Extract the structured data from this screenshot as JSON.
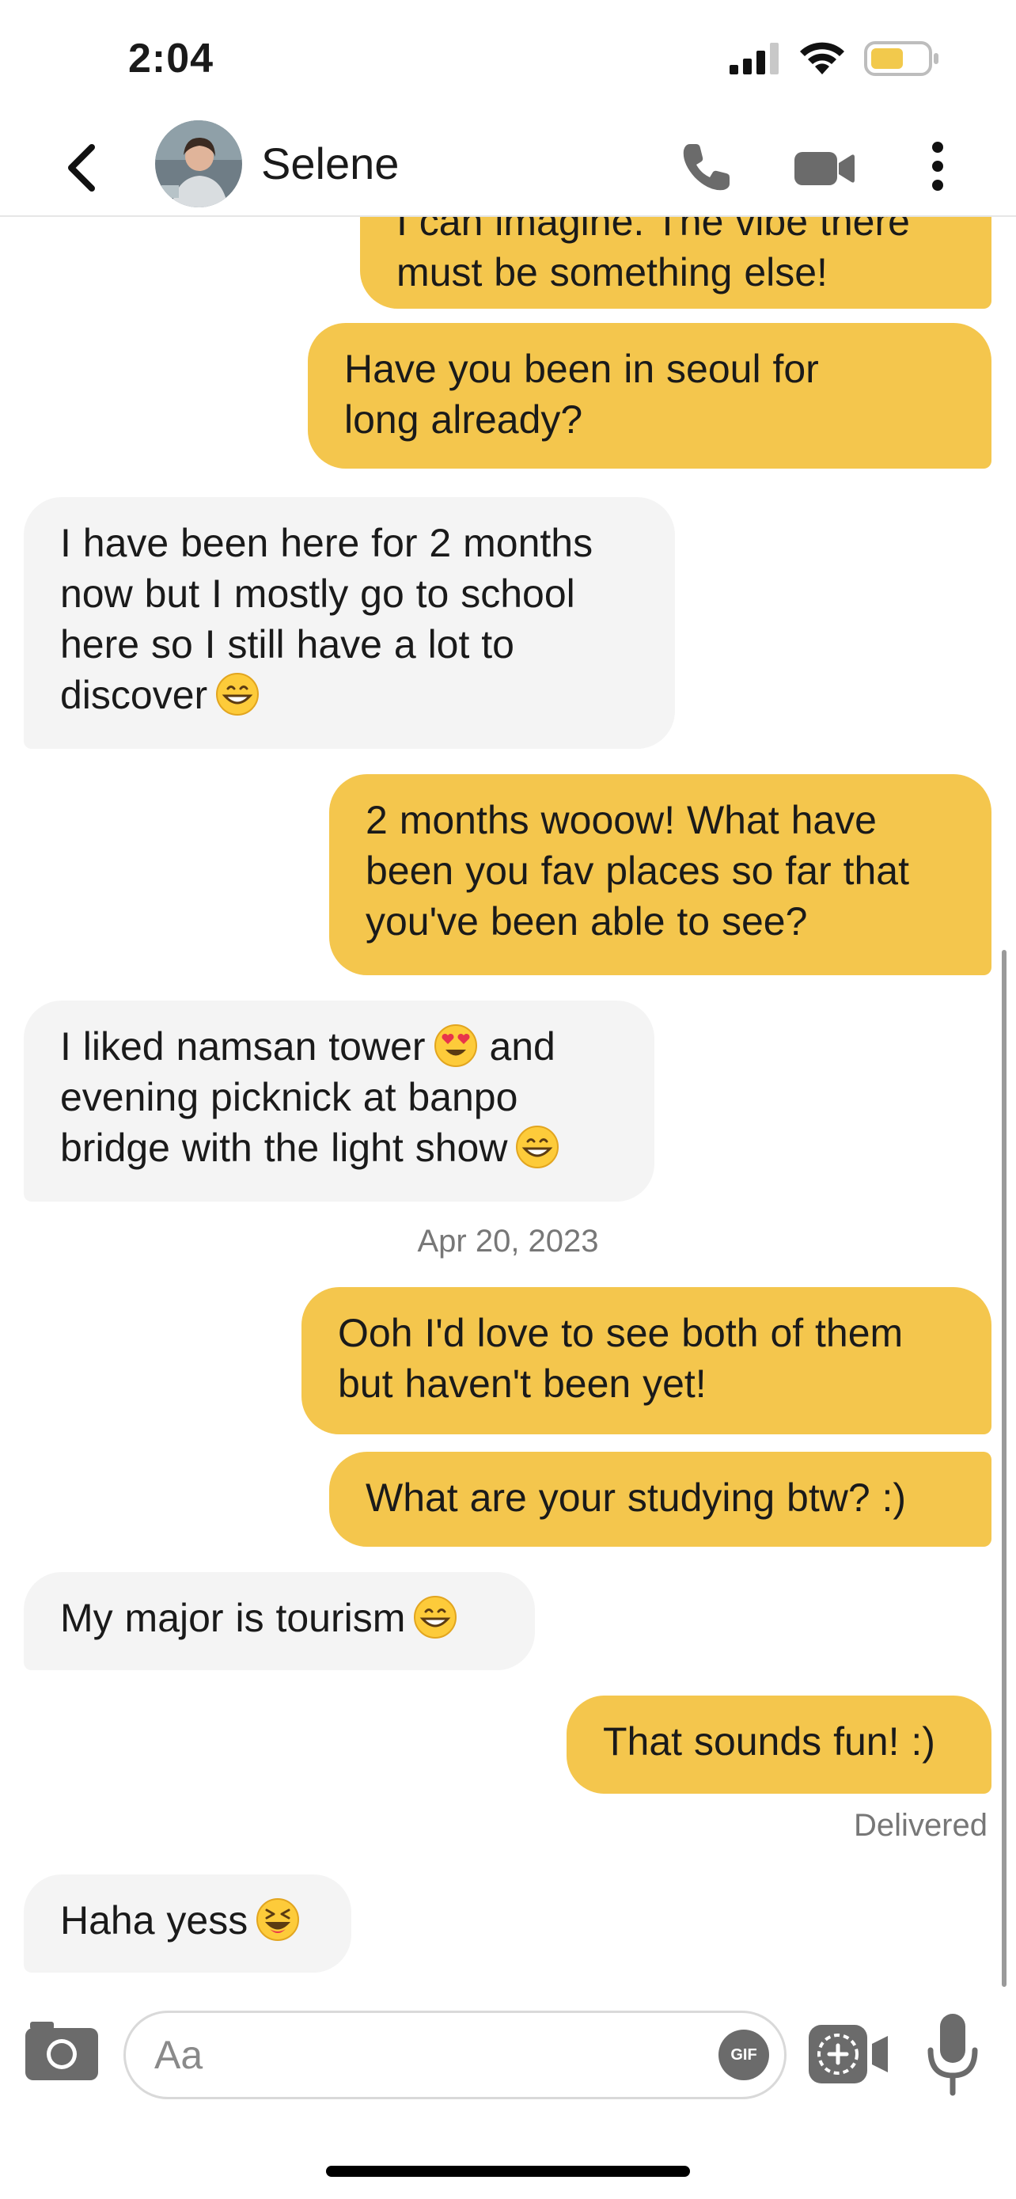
{
  "status_bar": {
    "time": "2:04",
    "battery_color": "#f2c94c"
  },
  "header": {
    "contact_name": "Selene",
    "icons": [
      "back-chevron-icon",
      "phone-icon",
      "video-camera-icon",
      "more-vertical-icon"
    ]
  },
  "messages": [
    {
      "side": "out",
      "text": "I can imagine. The vibe there\nmust be something else!"
    },
    {
      "side": "out",
      "text": "Have you been in seoul for\nlong already?"
    },
    {
      "side": "in",
      "text": "I have been here for 2 months\nnow but I mostly go to school\nhere so I still have a lot to\ndiscover",
      "emoji": "grinning-face"
    },
    {
      "side": "out",
      "text": "2 months wooow! What have\nbeen you fav places so far that\nyou've been able to see?"
    },
    {
      "side": "in",
      "text_a": "I liked namsan tower",
      "emoji_a": "heart-eyes",
      "text_b": " and\nevening picknick at banpo\nbridge with the light show",
      "emoji_b": "grinning-face"
    },
    {
      "side": "out",
      "text": "Ooh I'd love to see both of them\nbut haven't been yet!"
    },
    {
      "side": "out",
      "text": "What are your studying btw? :)"
    },
    {
      "side": "in",
      "text": "My major is tourism",
      "emoji": "grinning-face"
    },
    {
      "side": "out",
      "text": "That sounds fun! :)"
    },
    {
      "side": "in",
      "text": "Haha yess",
      "emoji": "laughing-squint-face"
    }
  ],
  "date_separator": "Apr 20, 2023",
  "delivered_label": "Delivered",
  "composer": {
    "placeholder": "Aa",
    "gif_label": "GIF"
  },
  "colors": {
    "outgoing_bubble": "#f4c64d",
    "incoming_bubble": "#f4f4f4"
  }
}
